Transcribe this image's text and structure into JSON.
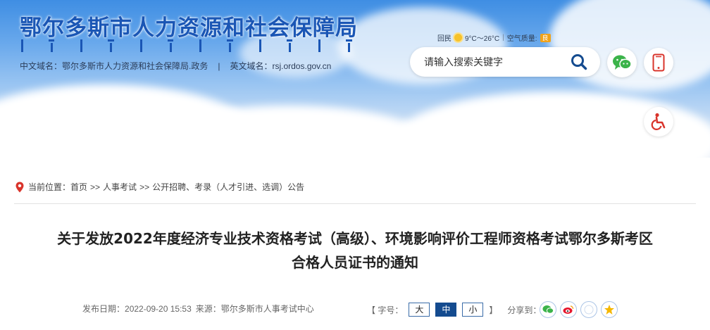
{
  "header": {
    "site_title": "鄂尔多斯市人力资源和社会保障局",
    "cn_domain": "中文域名：鄂尔多斯市人力资源和社会保障局.政务",
    "separator": "|",
    "en_domain": "英文域名：rsj.ordos.gov.cn",
    "weather": {
      "city": "回民",
      "temperature": "9°C～26°C",
      "air_label": "空气质量:",
      "air_value": "良"
    },
    "search": {
      "placeholder": "请输入搜索关键字"
    },
    "icons": [
      "search-icon",
      "wechat-icon",
      "mobile-icon",
      "accessibility-icon"
    ],
    "colors": {
      "title_blue": "#1a56b5",
      "search_icon": "#144b8f",
      "wechat_green": "#3bb34a",
      "accessibility_red": "#d9342b"
    }
  },
  "breadcrumb": {
    "label": "当前位置：",
    "items": [
      "首页",
      "人事考试",
      "公开招聘、考录（人才引进、选调）公告"
    ],
    "arrow": ">>"
  },
  "article": {
    "title_line1": "关于发放2022年度经济专业技术资格考试（高级）、环境影响评价工程师资格考试鄂尔多斯考区",
    "title_line2": "合格人员证书的通知",
    "publish_label": "发布日期：",
    "publish_date": "2022-09-20 15:53",
    "source_label": "来源：",
    "source": "鄂尔多斯市人事考试中心",
    "fontsize_label": "【 字号：",
    "fontsize_options": [
      "大",
      "中",
      "小"
    ],
    "fontsize_selected": "中",
    "fontsize_close": "】",
    "share_label": "分享到：",
    "share_icons": [
      "wechat-share-icon",
      "weibo-share-icon",
      "qq-share-icon",
      "qzone-share-icon"
    ]
  }
}
